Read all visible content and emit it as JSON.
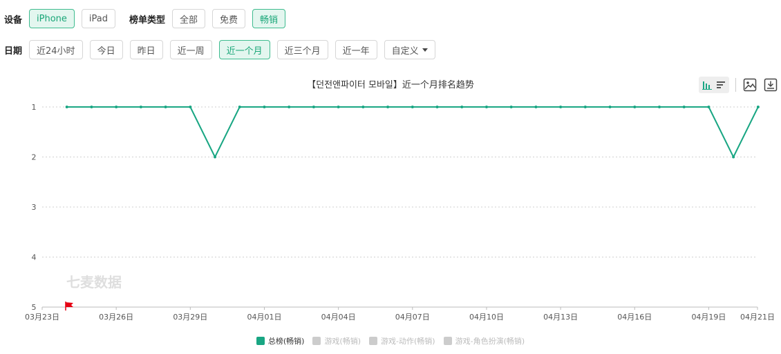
{
  "filters": {
    "device_label": "设备",
    "devices": [
      {
        "label": "iPhone",
        "active": true
      },
      {
        "label": "iPad",
        "active": false
      }
    ],
    "list_type_label": "榜单类型",
    "list_types": [
      {
        "label": "全部",
        "active": false
      },
      {
        "label": "免费",
        "active": false
      },
      {
        "label": "畅销",
        "active": true
      }
    ],
    "period_label": "日期",
    "periods": [
      {
        "label": "近24小时",
        "active": false
      },
      {
        "label": "今日",
        "active": false
      },
      {
        "label": "昨日",
        "active": false
      },
      {
        "label": "近一周",
        "active": false
      },
      {
        "label": "近一个月",
        "active": true
      },
      {
        "label": "近三个月",
        "active": false
      },
      {
        "label": "近一年",
        "active": false
      }
    ],
    "custom_label": "自定义"
  },
  "toolbar": {
    "icons": [
      "bar-chart-icon",
      "list-icon",
      "image-icon",
      "download-icon"
    ]
  },
  "colors": {
    "accent": "#19a683",
    "active_bg": "#e3f6ef",
    "legend_inactive": "#cccccc",
    "flag": "#e60012"
  },
  "chart_data": {
    "type": "line",
    "title": "【던전앤파이터 모바일】近一个月排名趋势",
    "watermark": "七麦数据",
    "x": [
      "03月24日",
      "03月25日",
      "03月26日",
      "03月27日",
      "03月28日",
      "03月29日",
      "03月30日",
      "03月31日",
      "04月01日",
      "04月02日",
      "04月03日",
      "04月04日",
      "04月05日",
      "04月06日",
      "04月07日",
      "04月08日",
      "04月09日",
      "04月10日",
      "04月11日",
      "04月12日",
      "04月13日",
      "04月14日",
      "04月15日",
      "04月16日",
      "04月17日",
      "04月18日",
      "04月19日",
      "04月20日",
      "04月21日"
    ],
    "x_tick_labels": [
      "03月23日",
      "03月26日",
      "03月29日",
      "04月01日",
      "04月04日",
      "04月07日",
      "04月10日",
      "04月13日",
      "04月16日",
      "04月19日",
      "04月21日"
    ],
    "y_ticks": [
      "1",
      "2",
      "3",
      "4",
      "5"
    ],
    "ylim": [
      1,
      5
    ],
    "y_inverted": true,
    "grid": true,
    "legend_position": "bottom",
    "series": [
      {
        "name": "总榜(畅销)",
        "active": true,
        "values": [
          1,
          1,
          1,
          1,
          1,
          1,
          2,
          1,
          1,
          1,
          1,
          1,
          1,
          1,
          1,
          1,
          1,
          1,
          1,
          1,
          1,
          1,
          1,
          1,
          1,
          1,
          1,
          2,
          1
        ]
      },
      {
        "name": "游戏(畅销)",
        "active": false,
        "values": []
      },
      {
        "name": "游戏-动作(畅销)",
        "active": false,
        "values": []
      },
      {
        "name": "游戏-角色扮演(畅销)",
        "active": false,
        "values": []
      }
    ]
  }
}
